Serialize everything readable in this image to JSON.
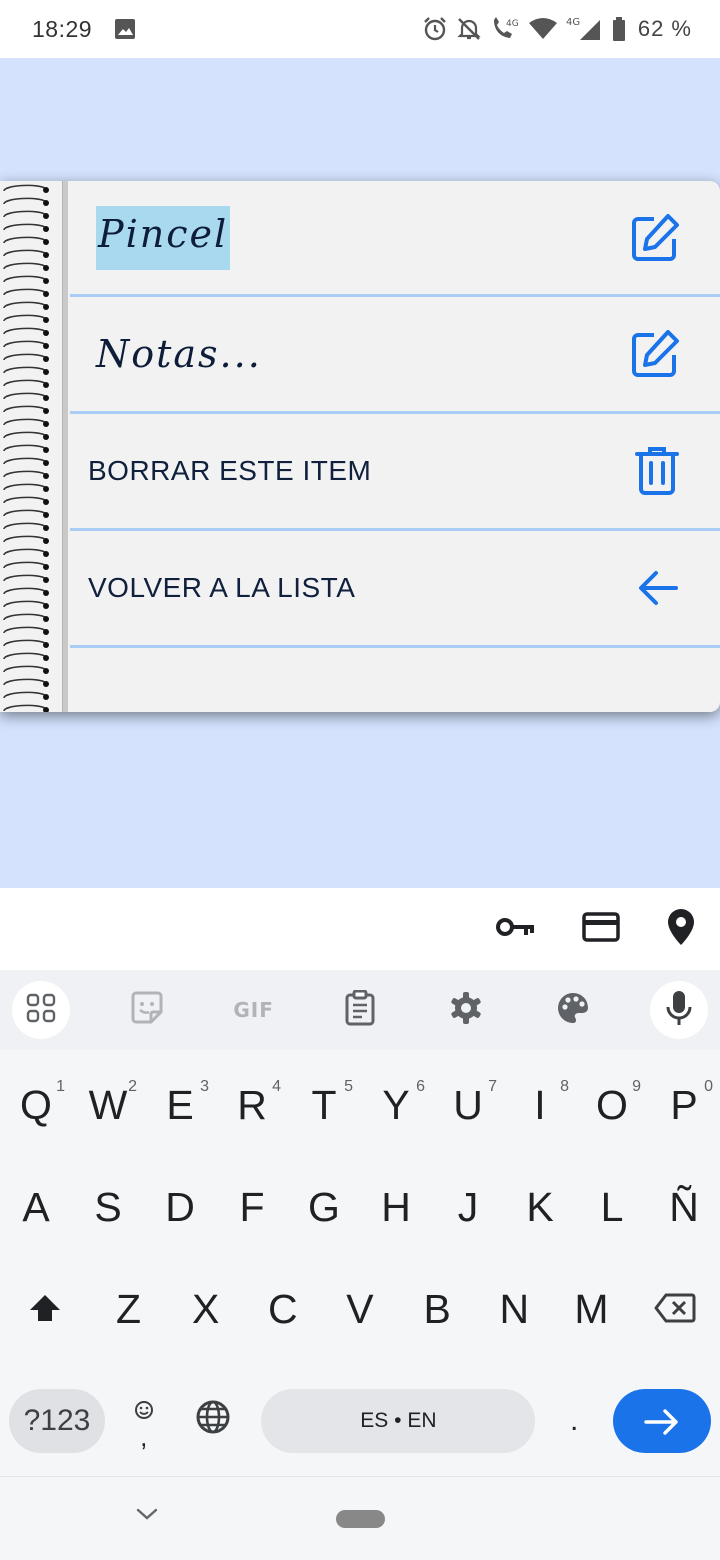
{
  "status": {
    "time": "18:29",
    "battery": "62 %"
  },
  "card": {
    "title": "Pincel",
    "notes_placeholder": "Notas...",
    "delete_label": "BORRAR ESTE ITEM",
    "back_label": "VOLVER A LA LISTA"
  },
  "colors": {
    "accent": "#1a73e8",
    "background": "#d4e2fe",
    "row_line": "#a9cdf5",
    "title_highlight": "#a9d9ef"
  },
  "keyboard": {
    "row1": [
      {
        "key": "Q",
        "hint": "1"
      },
      {
        "key": "W",
        "hint": "2"
      },
      {
        "key": "E",
        "hint": "3"
      },
      {
        "key": "R",
        "hint": "4"
      },
      {
        "key": "T",
        "hint": "5"
      },
      {
        "key": "Y",
        "hint": "6"
      },
      {
        "key": "U",
        "hint": "7"
      },
      {
        "key": "I",
        "hint": "8"
      },
      {
        "key": "O",
        "hint": "9"
      },
      {
        "key": "P",
        "hint": "0"
      }
    ],
    "row2": [
      "A",
      "S",
      "D",
      "F",
      "G",
      "H",
      "J",
      "K",
      "L",
      "Ñ"
    ],
    "row3": [
      "Z",
      "X",
      "C",
      "V",
      "B",
      "N",
      "M"
    ],
    "symbols_label": "?123",
    "comma": ",",
    "space_label": "ES • EN",
    "period": "."
  },
  "icons": {
    "autofill": [
      "key-icon",
      "credit-card-icon",
      "location-pin-icon"
    ],
    "toolbar": [
      "apps-grid-icon",
      "sticker-icon",
      "gif-icon",
      "clipboard-icon",
      "settings-icon",
      "palette-icon",
      "microphone-icon"
    ],
    "gif_label": "GIF"
  }
}
